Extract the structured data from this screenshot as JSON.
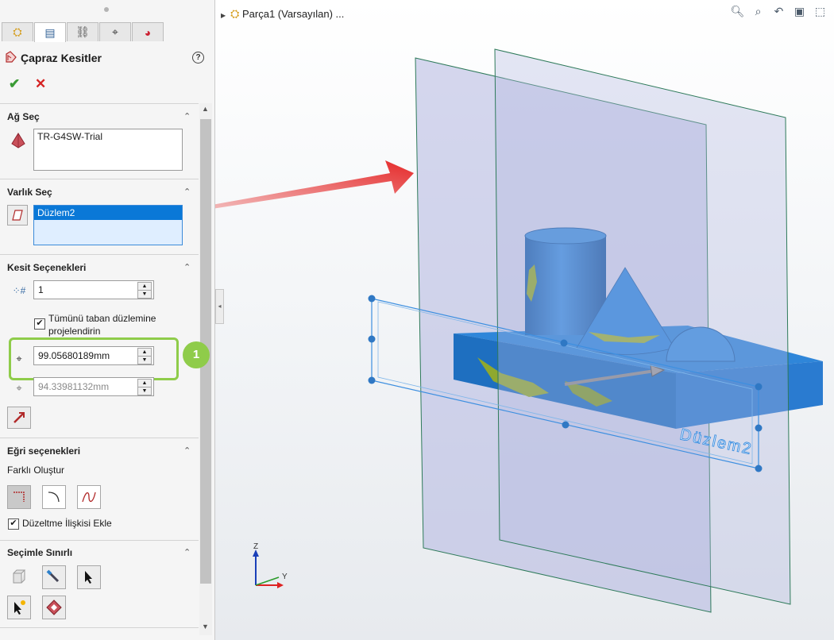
{
  "tabs": [
    {
      "name": "featuremanager-tab",
      "icon": "feature-tree-icon",
      "glyph": "⛭"
    },
    {
      "name": "propertymanager-tab",
      "icon": "property-icon",
      "glyph": "▤"
    },
    {
      "name": "configuration-tab",
      "icon": "config-icon",
      "glyph": "⛓"
    },
    {
      "name": "dimxpert-tab",
      "icon": "crosshair-icon",
      "glyph": "⌖"
    },
    {
      "name": "display-tab",
      "icon": "display-icon",
      "glyph": "◕"
    }
  ],
  "panel": {
    "title": "Çapraz Kesitler",
    "ok": "✔",
    "cancel": "✕",
    "help": "?"
  },
  "sections": {
    "mesh": {
      "title": "Ağ Seç",
      "item": "TR-G4SW-Trial"
    },
    "entity": {
      "title": "Varlık Seç",
      "item": "Düzlem2"
    },
    "options": {
      "title": "Kesit Seçenekleri",
      "count": "1",
      "project_label": "Tümünü taban düzlemine projelendirin",
      "project_checked": "✔",
      "d1": "99.05680189mm",
      "d2": "94.33981132mm",
      "callout": "1"
    },
    "curve": {
      "title": "Eğri seçenekleri",
      "create_label": "Farklı Oluştur",
      "smooth_label": "Düzeltme İlişkisi Ekle",
      "smooth_checked": "✔"
    },
    "limit": {
      "title": "Seçimle Sınırlı"
    }
  },
  "graphics": {
    "tree_node": "Parça1  (Varsayılan) ...",
    "plane_label": "Düzlem2",
    "axis_z": "Z",
    "axis_y": "Y",
    "hud": [
      "zoom-fit-icon",
      "zoom-area-icon",
      "previous-view-icon",
      "section-view-icon",
      "view-orientation-icon"
    ]
  },
  "colors": {
    "accent_blue": "#0a78d7",
    "callout_green": "#8fcc4a",
    "part_blue": "#1f72c6",
    "plane": "#b3b6e0",
    "arrow_red": "#e41e1e"
  }
}
